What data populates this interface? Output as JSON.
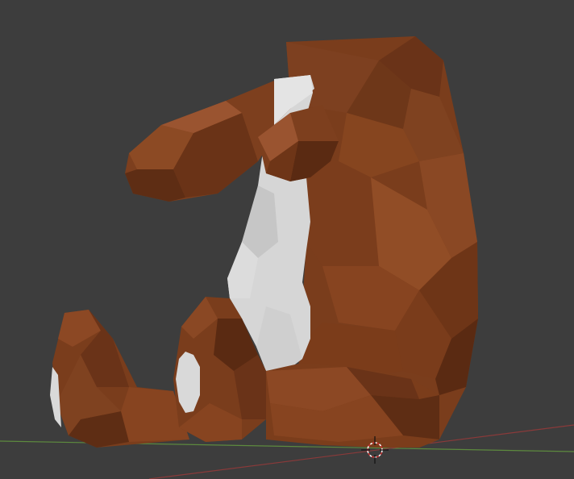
{
  "viewport": {
    "background_color": "#3d3d3d",
    "model": {
      "kind": "low-poly bear figure",
      "primary_color": "#7a3d1c",
      "shadow_color": "#4a2410",
      "highlight_color": "#a0552a",
      "patch_color": "#d4d4d4"
    },
    "axes": {
      "x_axis_color": "#8a3a3a",
      "y_axis_color": "#5a8a3a"
    },
    "cursor_icon": "3d-cursor-icon"
  }
}
